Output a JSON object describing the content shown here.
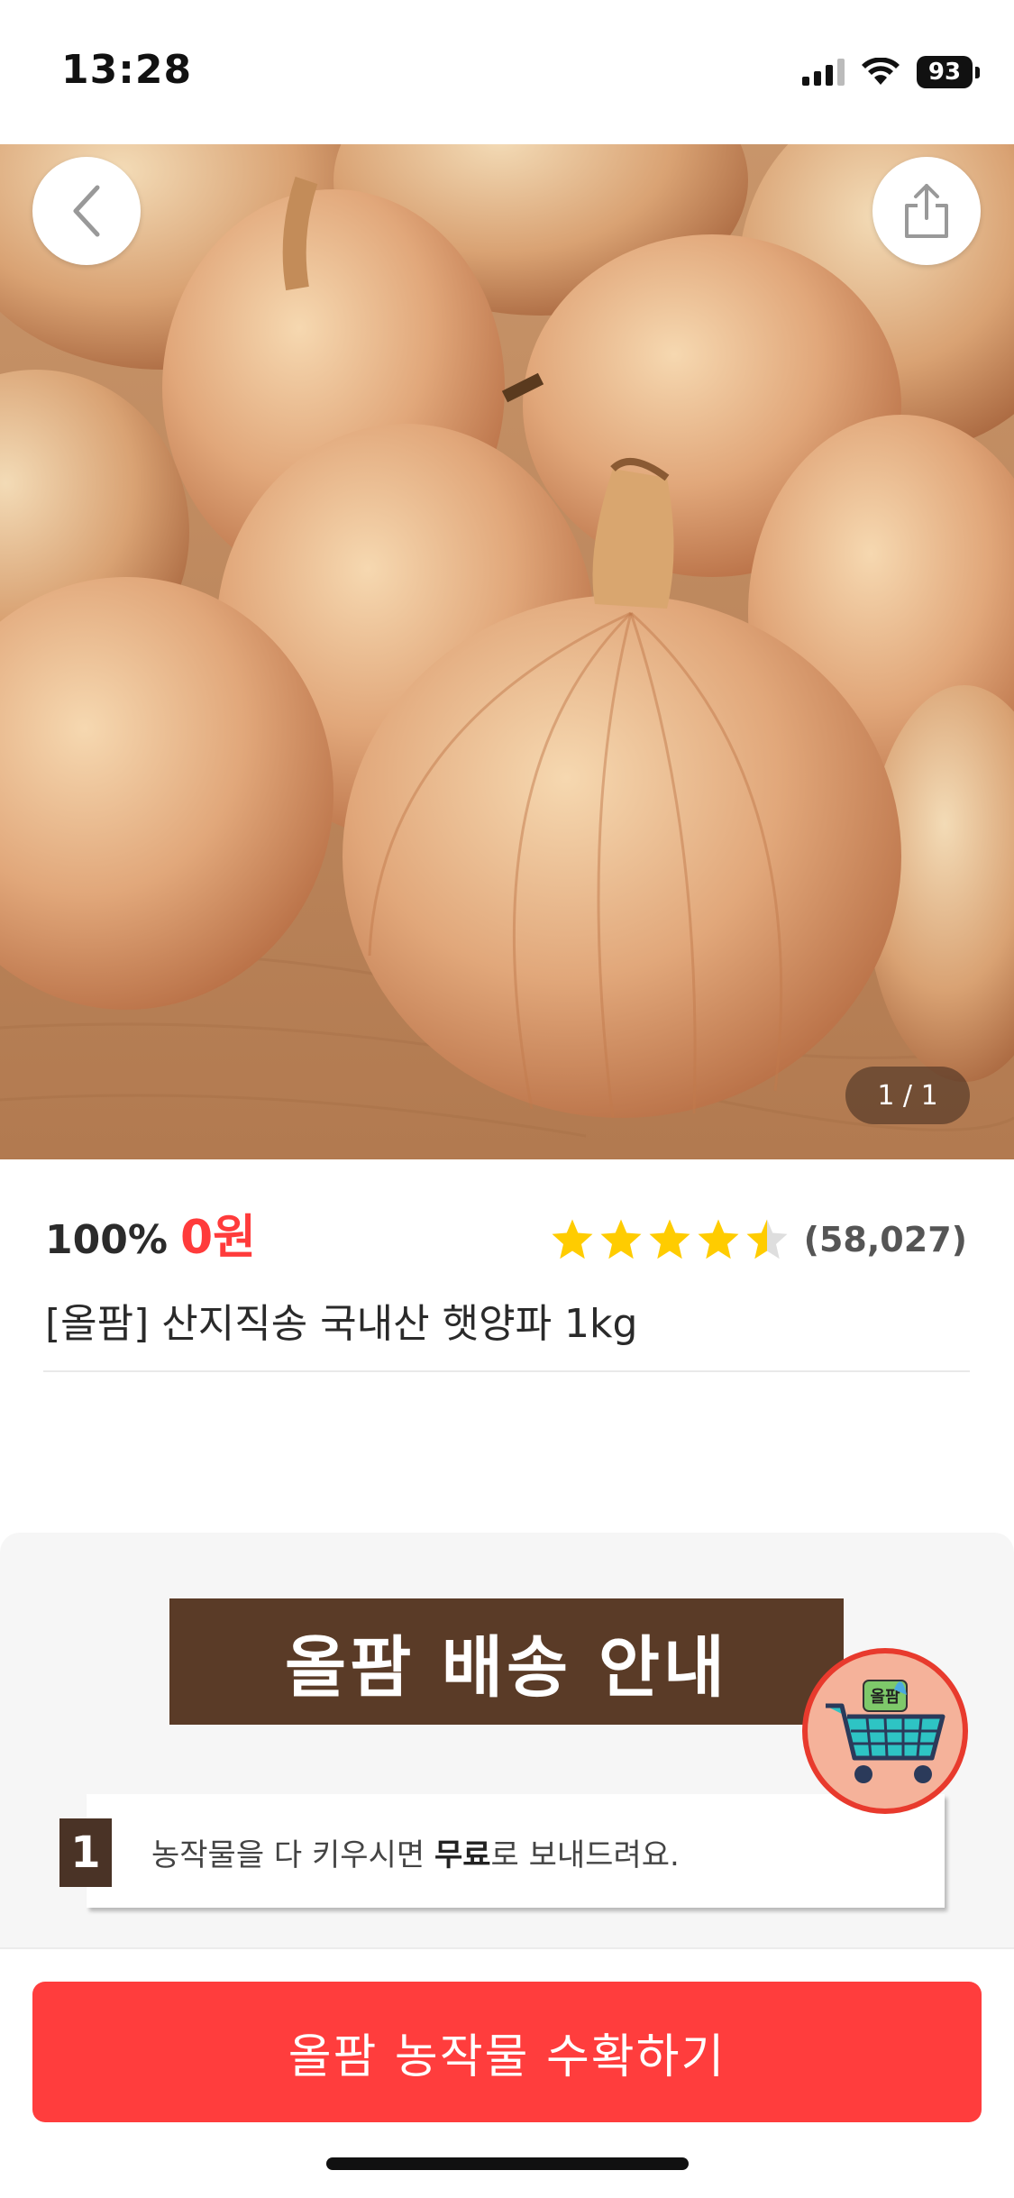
{
  "status_bar": {
    "time": "13:28",
    "battery": "93"
  },
  "hero": {
    "page_indicator": "1 / 1"
  },
  "product": {
    "discount": "100%",
    "price": "0원",
    "rating": 4.5,
    "review_count": "(58,027)",
    "title": "[올팜] 산지직송 국내산 햇양파 1kg"
  },
  "delivery": {
    "banner_title": "올팜 배송 안내",
    "step_number": "1",
    "step_text_before": "농작물을 다 키우시면 ",
    "step_text_bold": "무료",
    "step_text_after": "로 보내드려요."
  },
  "cart_fab": {
    "label": "올팜"
  },
  "cta": {
    "label": "올팜 농작물 수확하기"
  },
  "colors": {
    "accent": "#ff3d3d",
    "banner": "#5a3b27",
    "star": "#ffcc00"
  },
  "icons": [
    "back-chevron-icon",
    "share-icon",
    "star-icon",
    "cart-icon",
    "wifi-icon",
    "signal-icon",
    "battery-icon"
  ]
}
